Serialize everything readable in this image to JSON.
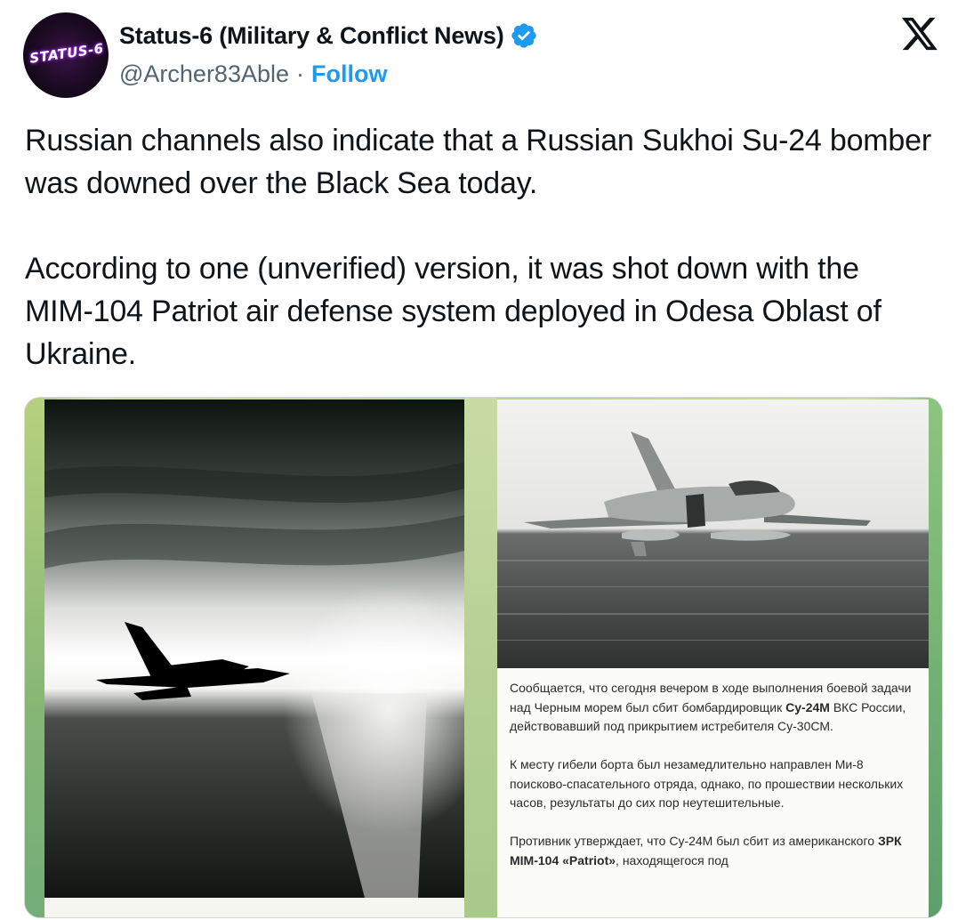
{
  "header": {
    "avatar_text": "STATUS-6",
    "display_name": "Status-6 (Military & Conflict News)",
    "handle": "@Archer83Able",
    "separator": "·",
    "follow_label": "Follow"
  },
  "tweet": {
    "paragraphs": [
      "Russian channels also indicate that a Russian Sukhoi Su-24 bomber was downed over the Black Sea today.",
      "According to one (unverified) version, it was shot down with the MIM-104 Patriot air defense system deployed in Odesa Oblast of Ukraine."
    ]
  },
  "media": {
    "caption": {
      "p1_a": "Сообщается, что сегодня вечером в ходе выполнения боевой задачи над Черным морем был сбит бомбардировщик ",
      "p1_b": "Су-24М",
      "p1_c": " ВКС России, действовавший под прикрытием истребителя Су-30СМ.",
      "p2": "К месту гибели борта был незамедлительно направлен Ми-8 поисково-спасательного отряда, однако, по прошествии нескольких часов, результаты до сих пор неутешительные.",
      "p3_a": "Противник утверждает, что Су-24М был сбит из американского ",
      "p3_b": "ЗРК MIM-104 «Patriot»",
      "p3_c": ", находящегося под"
    }
  },
  "colors": {
    "text": "#0f1419",
    "secondary": "#536471",
    "accent": "#1d9bf0",
    "border": "#cfd9de"
  },
  "icons": {
    "verified": "verified-badge-icon",
    "x": "x-logo-icon"
  }
}
